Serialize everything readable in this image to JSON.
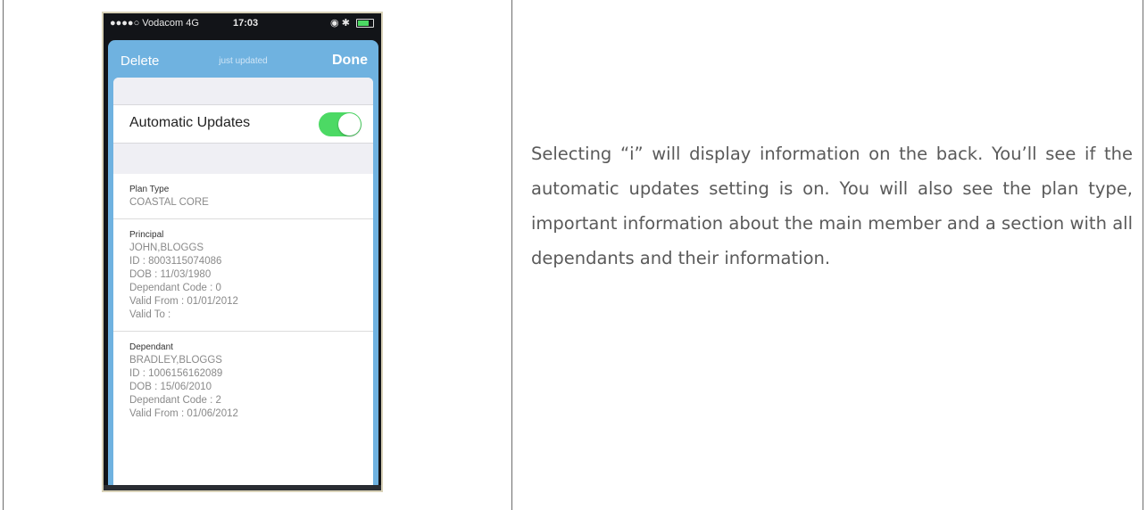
{
  "phone": {
    "status_bar": {
      "carrier": "●●●●○ Vodacom  4G",
      "time": "17:03",
      "icons": [
        "alarm-icon",
        "bluetooth-icon",
        "battery-icon"
      ]
    },
    "nav": {
      "delete_label": "Delete",
      "status": "just updated",
      "done_label": "Done"
    },
    "automatic_updates": {
      "label": "Automatic Updates",
      "enabled": true,
      "toggle_color": "#4cd964"
    },
    "plan": {
      "heading": "Plan Type",
      "value": "COASTAL CORE"
    },
    "principal": {
      "heading": "Principal",
      "lines": [
        "JOHN,BLOGGS",
        "ID : 8003115074086",
        "DOB : 11/03/1980",
        "Dependant Code : 0",
        "Valid From : 01/01/2012",
        "Valid To :"
      ]
    },
    "dependant": {
      "heading": "Dependant",
      "lines": [
        "BRADLEY,BLOGGS",
        "ID : 1006156162089",
        "DOB : 15/06/2010",
        "Dependant Code : 2",
        "Valid From : 01/06/2012"
      ]
    },
    "accent_color": "#6fb2e0"
  },
  "description": "Selecting “i” will display information on the back. You’ll see if the automatic updates setting is on. You will also see the plan type, important information about the main member and a section with all dependants and their information."
}
